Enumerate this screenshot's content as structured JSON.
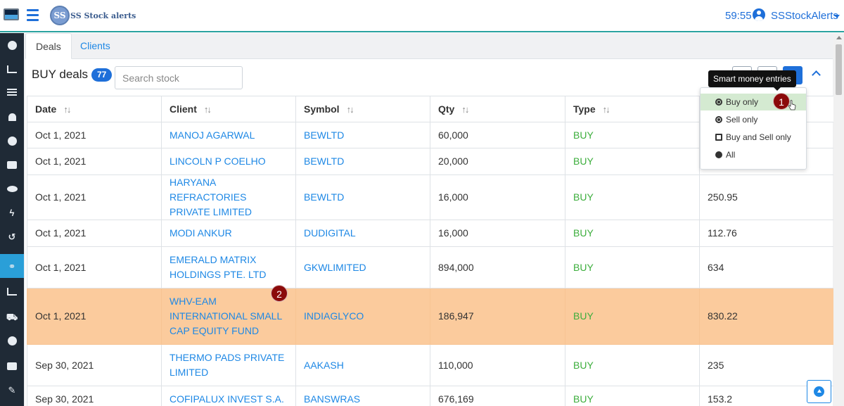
{
  "header": {
    "logo_badge": "SS",
    "logo_text": "SS Stock alerts",
    "timer": "59:55",
    "user_name": "SSStockAlerts"
  },
  "sidebar": {
    "items": [
      {
        "icon": "dashboard-icon"
      },
      {
        "icon": "chart-line-icon"
      },
      {
        "icon": "list-icon"
      },
      {
        "icon": "bell-icon"
      },
      {
        "icon": "info-icon"
      },
      {
        "icon": "briefcase-icon"
      },
      {
        "icon": "eye-icon"
      },
      {
        "icon": "bolt-icon"
      },
      {
        "icon": "history-icon"
      },
      {
        "icon": "handshake-icon",
        "active": true
      },
      {
        "icon": "bar-chart-icon"
      },
      {
        "icon": "cart-icon"
      },
      {
        "icon": "p-badge-icon"
      },
      {
        "icon": "envelope-icon"
      },
      {
        "icon": "wrench-icon"
      }
    ]
  },
  "tabs": [
    {
      "label": "Deals",
      "active": true
    },
    {
      "label": "Clients",
      "active": false
    }
  ],
  "deals": {
    "title": "BUY deals",
    "count": "77",
    "search_placeholder": "Search stock"
  },
  "table": {
    "columns": [
      "Date",
      "Client",
      "Symbol",
      "Qty",
      "Type",
      ""
    ],
    "rows": [
      {
        "date": "Oct 1, 2021",
        "client": "MANOJ AGARWAL",
        "symbol": "BEWLTD",
        "qty": "60,000",
        "type": "BUY",
        "price": ""
      },
      {
        "date": "Oct 1, 2021",
        "client": "LINCOLN P COELHO",
        "symbol": "BEWLTD",
        "qty": "20,000",
        "type": "BUY",
        "price": ""
      },
      {
        "date": "Oct 1, 2021",
        "client": "HARYANA REFRACTORIES PRIVATE LIMITED",
        "symbol": "BEWLTD",
        "qty": "16,000",
        "type": "BUY",
        "price": "250.95"
      },
      {
        "date": "Oct 1, 2021",
        "client": "MODI ANKUR",
        "symbol": "DUDIGITAL",
        "qty": "16,000",
        "type": "BUY",
        "price": "112.76"
      },
      {
        "date": "Oct 1, 2021",
        "client": "EMERALD MATRIX HOLDINGS PTE. LTD",
        "symbol": "GKWLIMITED",
        "qty": "894,000",
        "type": "BUY",
        "price": "634"
      },
      {
        "date": "Oct 1, 2021",
        "client": "WHV-EAM INTERNATIONAL SMALL CAP EQUITY FUND",
        "symbol": "INDIAGLYCO",
        "qty": "186,947",
        "type": "BUY",
        "price": "830.22",
        "highlight": true
      },
      {
        "date": "Sep 30, 2021",
        "client": "THERMO PADS PRIVATE LIMITED",
        "symbol": "AAKASH",
        "qty": "110,000",
        "type": "BUY",
        "price": "235"
      },
      {
        "date": "Sep 30, 2021",
        "client": "COFIPALUX INVEST S.A.",
        "symbol": "BANSWRAS",
        "qty": "676,169",
        "type": "BUY",
        "price": "153.2"
      }
    ]
  },
  "dropdown": {
    "tooltip": "Smart money entries",
    "items": [
      {
        "label": "Buy only",
        "active": true
      },
      {
        "label": "Sell only"
      },
      {
        "label": "Buy and Sell only"
      },
      {
        "label": "All"
      }
    ]
  },
  "annotations": {
    "step1": "1",
    "step2": "2"
  },
  "colors": {
    "accent": "#1e6fd9",
    "highlight_row": "#fbcb9d",
    "buy_text": "#3cae3c",
    "sidebar_bg": "#1f2a36"
  }
}
